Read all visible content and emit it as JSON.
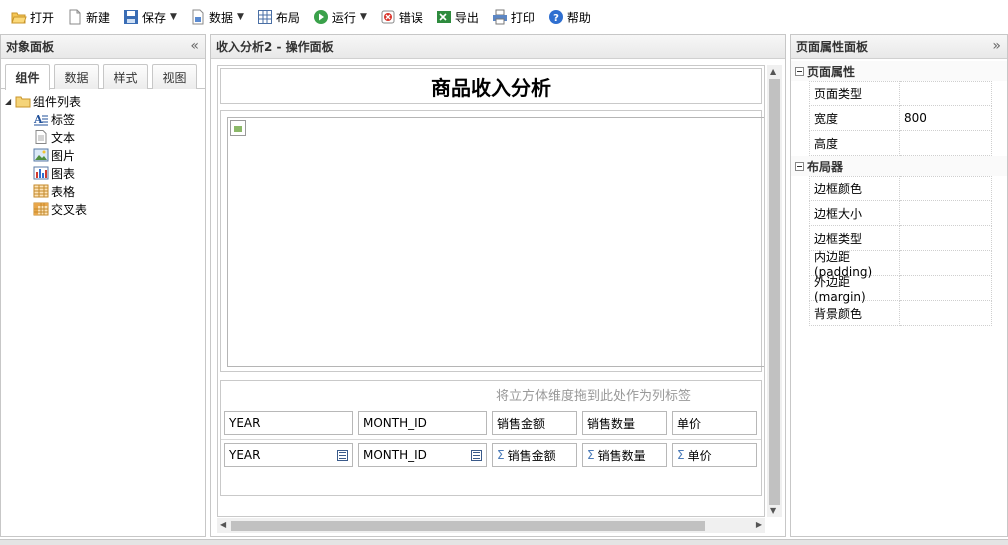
{
  "toolbar": {
    "items": [
      {
        "label": "打开",
        "icon": "folder-open-icon"
      },
      {
        "label": "新建",
        "icon": "new-file-icon"
      },
      {
        "label": "保存",
        "icon": "save-icon",
        "dropdown": true
      },
      {
        "label": "数据",
        "icon": "data-icon",
        "dropdown": true
      },
      {
        "label": "布局",
        "icon": "layout-grid-icon"
      },
      {
        "label": "运行",
        "icon": "run-play-icon",
        "dropdown": true
      },
      {
        "label": "错误",
        "icon": "error-bug-icon"
      },
      {
        "label": "导出",
        "icon": "excel-export-icon"
      },
      {
        "label": "打印",
        "icon": "printer-icon"
      },
      {
        "label": "帮助",
        "icon": "help-icon"
      }
    ]
  },
  "left_panel": {
    "title": "对象面板",
    "collapse_glyph": "«",
    "tabs": [
      "组件",
      "数据",
      "样式",
      "视图"
    ],
    "active_tab": 0,
    "tree": {
      "root_label": "组件列表",
      "items": [
        {
          "label": "标签",
          "icon": "label-icon"
        },
        {
          "label": "文本",
          "icon": "text-icon"
        },
        {
          "label": "图片",
          "icon": "image-icon"
        },
        {
          "label": "图表",
          "icon": "chart-icon"
        },
        {
          "label": "表格",
          "icon": "table-icon"
        },
        {
          "label": "交叉表",
          "icon": "crosstab-icon"
        }
      ]
    }
  },
  "center_panel": {
    "title": "收入分析2 - 操作面板",
    "report_title": "商品收入分析",
    "crosstab": {
      "column_hint": "将立方体维度拖到此处作为列标签",
      "header_row": [
        "YEAR",
        "MONTH_ID",
        "销售金额",
        "销售数量",
        "单价"
      ],
      "data_row": [
        {
          "label": "YEAR",
          "kind": "dimension"
        },
        {
          "label": "MONTH_ID",
          "kind": "dimension"
        },
        {
          "label": "销售金额",
          "kind": "measure"
        },
        {
          "label": "销售数量",
          "kind": "measure"
        },
        {
          "label": "单价",
          "kind": "measure"
        }
      ],
      "sigma": "Σ"
    }
  },
  "right_panel": {
    "title": "页面属性面板",
    "collapse_glyph": "»",
    "groups": [
      {
        "label": "页面属性",
        "rows": [
          {
            "key": "页面类型",
            "value": ""
          },
          {
            "key": "宽度",
            "value": "800"
          },
          {
            "key": "高度",
            "value": ""
          }
        ]
      },
      {
        "label": "布局器",
        "rows": [
          {
            "key": "边框颜色",
            "value": ""
          },
          {
            "key": "边框大小",
            "value": ""
          },
          {
            "key": "边框类型",
            "value": ""
          },
          {
            "key": "内边距(padding)",
            "value": ""
          },
          {
            "key": "外边距(margin)",
            "value": ""
          },
          {
            "key": "背景颜色",
            "value": ""
          }
        ]
      }
    ]
  },
  "colors": {
    "panel_border": "#c7c7c7",
    "scroll_thumb": "#c1c1c1",
    "hint_text": "#999999"
  }
}
